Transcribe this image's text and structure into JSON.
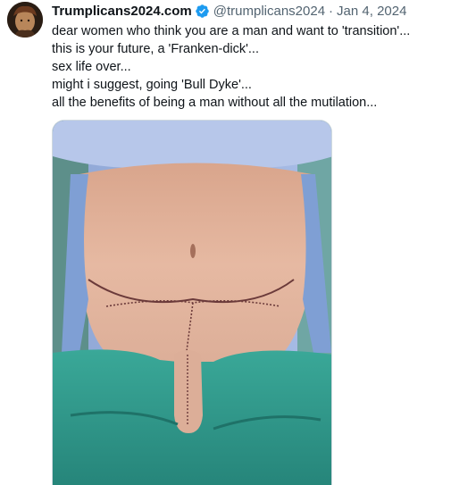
{
  "tweet": {
    "author": {
      "display_name": "Trumplicans2024.com",
      "verified": true,
      "handle": "@trumplicans2024",
      "avatar": "avatar-photo"
    },
    "separator": "·",
    "date": "Jan 4, 2024",
    "text_lines": [
      "dear women who think you are a man and want to 'transition'...",
      "this is your future, a 'Franken-dick'...",
      "sex life over...",
      "might i suggest, going 'Bull Dyke'...",
      "all the benefits of being a man without all the mutilation..."
    ],
    "media": {
      "kind": "photo"
    }
  },
  "colors": {
    "text": "#0f1419",
    "secondary": "#536471",
    "verified_blue": "#1d9bf0",
    "border": "#cfd9de",
    "surgical_drape": "#2f9e8f"
  }
}
